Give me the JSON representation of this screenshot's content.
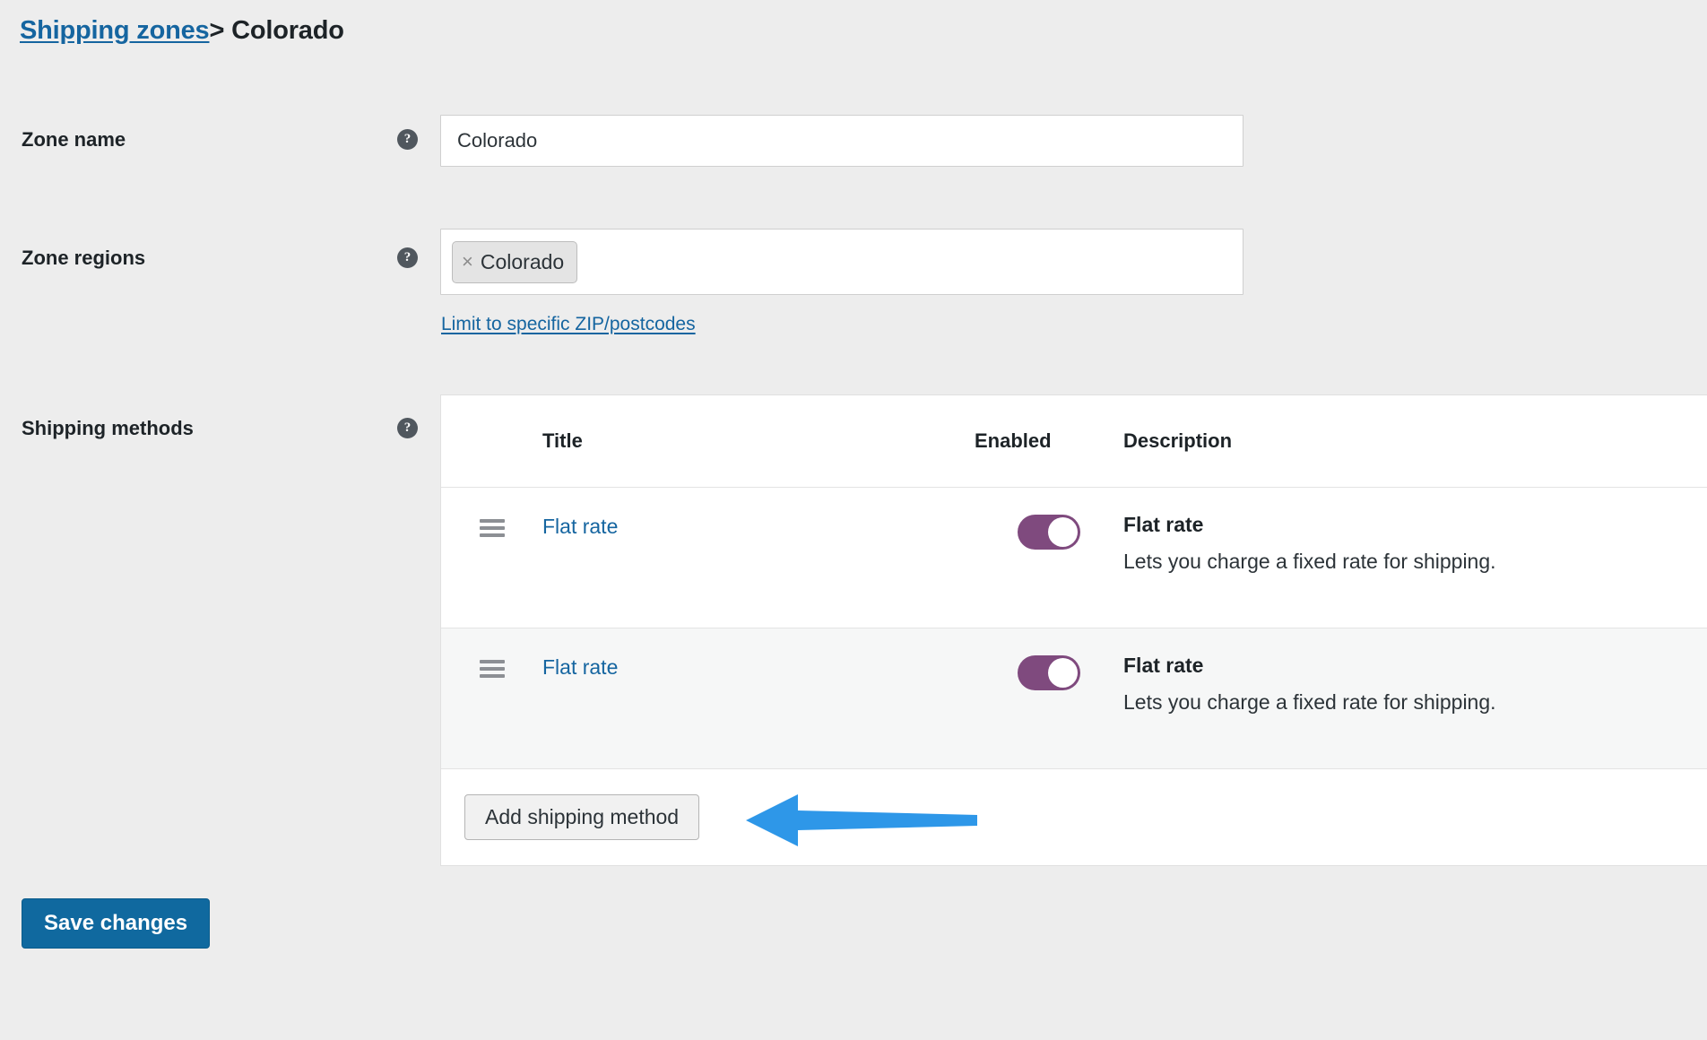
{
  "breadcrumb": {
    "parent_link": "Shipping zones",
    "separator": ">",
    "current": "Colorado"
  },
  "form": {
    "zone_name": {
      "label": "Zone name",
      "help_glyph": "?",
      "value": "Colorado",
      "placeholder": "Zone name"
    },
    "zone_regions": {
      "label": "Zone regions",
      "help_glyph": "?",
      "tags": [
        {
          "label": "Colorado",
          "remove_glyph": "×"
        }
      ],
      "limit_link": "Limit to specific ZIP/postcodes"
    },
    "shipping_methods": {
      "label": "Shipping methods",
      "help_glyph": "?"
    }
  },
  "methods_table": {
    "columns": {
      "handle": "",
      "title": "Title",
      "enabled": "Enabled",
      "description": "Description"
    },
    "rows": [
      {
        "title": "Flat rate",
        "enabled": true,
        "desc_title": "Flat rate",
        "desc_text": "Lets you charge a fixed rate for shipping."
      },
      {
        "title": "Flat rate",
        "enabled": true,
        "desc_title": "Flat rate",
        "desc_text": "Lets you charge a fixed rate for shipping."
      }
    ],
    "add_method_button": "Add shipping method"
  },
  "actions": {
    "save_label": "Save changes"
  },
  "colors": {
    "page_background": "#ededed",
    "link_blue": "#1565a0",
    "primary_button": "#10699f",
    "toggle_on": "#7f4a7e",
    "annotation_arrow": "#2e97e8",
    "row_alt_background": "#f6f7f7"
  }
}
